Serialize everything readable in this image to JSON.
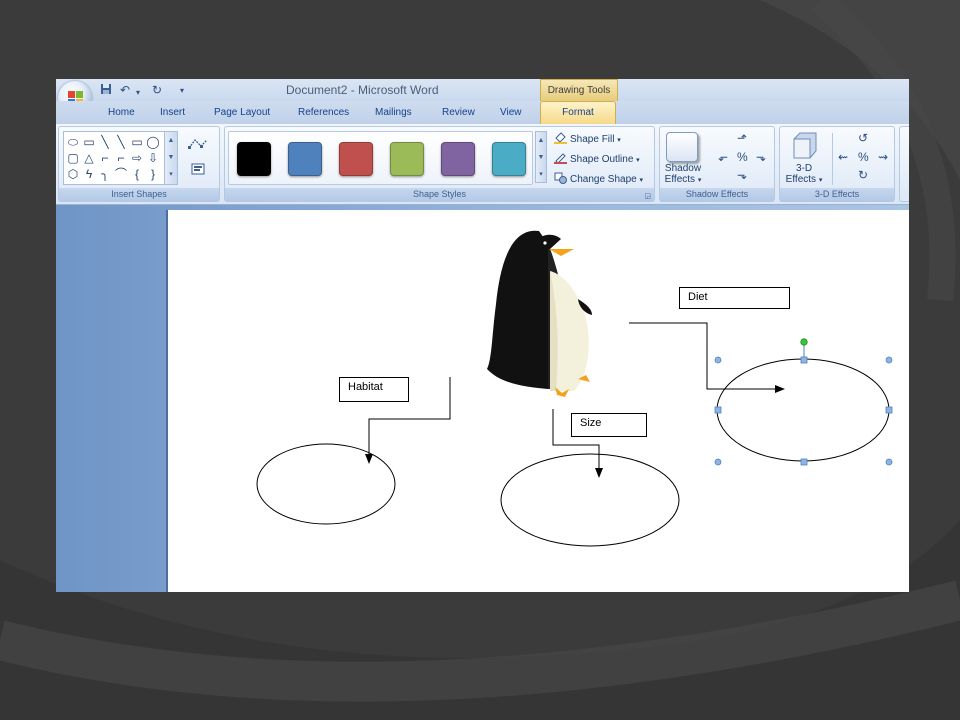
{
  "window": {
    "title": "Document2 - Microsoft Word",
    "context_header": "Drawing Tools"
  },
  "tabs": [
    {
      "label": "Home"
    },
    {
      "label": "Insert"
    },
    {
      "label": "Page Layout"
    },
    {
      "label": "References"
    },
    {
      "label": "Mailings"
    },
    {
      "label": "Review"
    },
    {
      "label": "View"
    }
  ],
  "active_tab": "Format",
  "ribbon": {
    "insert_shapes": {
      "label": "Insert Shapes",
      "shapes": [
        "⬭",
        "▭",
        "╲",
        "╲",
        "▭",
        "◯",
        "▢",
        "△",
        "⌐",
        "⌐",
        "⇨",
        "⇩",
        "⬡",
        "ϟ",
        "╮",
        "⌒",
        "{",
        "}"
      ]
    },
    "shape_styles": {
      "label": "Shape Styles",
      "swatches": [
        "#000000",
        "#4f81bd",
        "#c0504d",
        "#9bbb59",
        "#8064a2",
        "#4bacc6"
      ],
      "shape_fill": "Shape Fill",
      "shape_outline": "Shape Outline",
      "change_shape": "Change Shape"
    },
    "shadow_effects": {
      "label": "Shadow Effects",
      "button_line1": "Shadow",
      "button_line2": "Effects"
    },
    "three_d_effects": {
      "label": "3-D Effects",
      "button_line1": "3-D",
      "button_line2": "Effects"
    }
  },
  "document": {
    "callouts": {
      "habitat": "Habitat",
      "diet": "Diet",
      "size": "Size"
    }
  },
  "colors": {
    "selection_handle": "#4f81bd",
    "rotate_handle": "#33cc33",
    "beak": "#f4a21b"
  }
}
